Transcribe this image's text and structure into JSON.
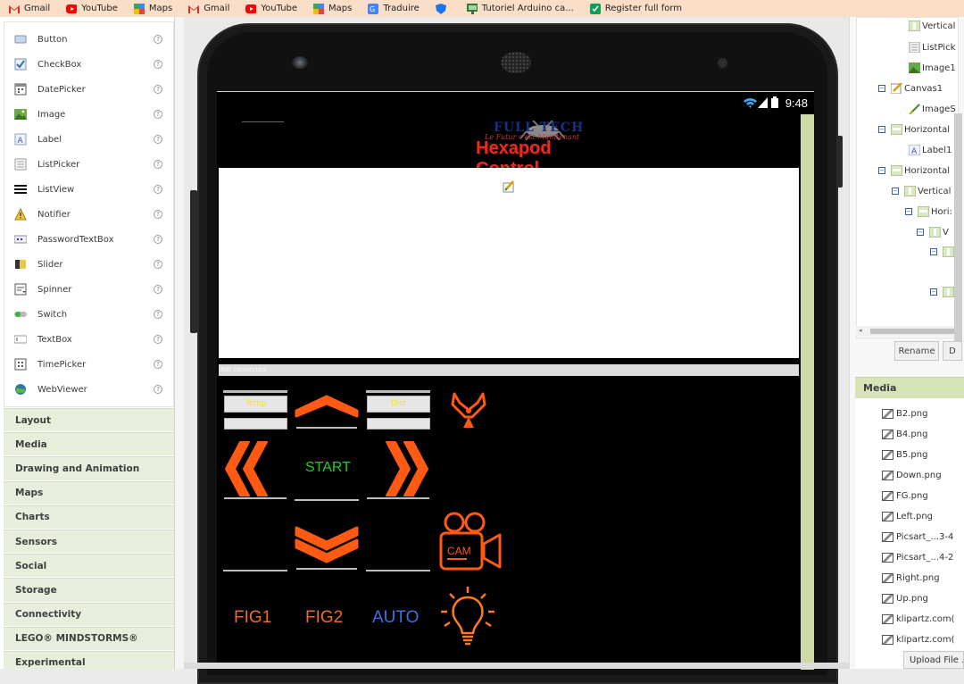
{
  "bookmarks": [
    {
      "label": "Gmail",
      "icon": "gmail-icon"
    },
    {
      "label": "YouTube",
      "icon": "youtube-icon"
    },
    {
      "label": "Maps",
      "icon": "maps-icon"
    },
    {
      "label": "Gmail",
      "icon": "gmail-icon"
    },
    {
      "label": "YouTube",
      "icon": "youtube-icon"
    },
    {
      "label": "Maps",
      "icon": "maps-icon"
    },
    {
      "label": "Traduire",
      "icon": "translate-icon"
    },
    {
      "label": "",
      "icon": "shield-icon"
    },
    {
      "label": "Tutoriel Arduino ca...",
      "icon": "monitor-icon"
    },
    {
      "label": "Register full form",
      "icon": "register-icon"
    }
  ],
  "palette": {
    "components": [
      {
        "label": "Button",
        "icon": "button-icon"
      },
      {
        "label": "CheckBox",
        "icon": "checkbox-icon"
      },
      {
        "label": "DatePicker",
        "icon": "datepicker-icon"
      },
      {
        "label": "Image",
        "icon": "image-icon"
      },
      {
        "label": "Label",
        "icon": "label-icon"
      },
      {
        "label": "ListPicker",
        "icon": "listpicker-icon"
      },
      {
        "label": "ListView",
        "icon": "listview-icon"
      },
      {
        "label": "Notifier",
        "icon": "notifier-icon"
      },
      {
        "label": "PasswordTextBox",
        "icon": "password-icon"
      },
      {
        "label": "Slider",
        "icon": "slider-icon"
      },
      {
        "label": "Spinner",
        "icon": "spinner-icon"
      },
      {
        "label": "Switch",
        "icon": "switch-icon"
      },
      {
        "label": "TextBox",
        "icon": "textbox-icon"
      },
      {
        "label": "TimePicker",
        "icon": "timepicker-icon"
      },
      {
        "label": "WebViewer",
        "icon": "webviewer-icon"
      }
    ],
    "help_glyph": "?",
    "categories": [
      "Layout",
      "Media",
      "Drawing and Animation",
      "Maps",
      "Charts",
      "Sensors",
      "Social",
      "Storage",
      "Connectivity",
      "LEGO® MINDSTORMS®",
      "Experimental"
    ]
  },
  "phone": {
    "time": "9:48",
    "logo_top": "FULL TECH",
    "logo_tagline": "Le Futur c'est Maintenant",
    "logo_title": "Hexapod Control",
    "status_strip": "Not connected",
    "box_left": "Temp",
    "box_right": "Dist",
    "start_label": "START",
    "fig1_label": "FIG1",
    "fig2_label": "FIG2",
    "auto_label": "AUTO",
    "cam_label": "CAM"
  },
  "tree": {
    "nodes": [
      {
        "label": "Vertical",
        "icon": "vertical-icon"
      },
      {
        "label": "ListPick",
        "icon": "listpicker-icon"
      },
      {
        "label": "Image1",
        "icon": "image-icon"
      },
      {
        "label": "Canvas1",
        "icon": "canvas-icon"
      },
      {
        "label": "ImageS",
        "icon": "imagesprite-icon"
      },
      {
        "label": "Horizontal",
        "icon": "horizontal-icon"
      },
      {
        "label": "Label1",
        "icon": "label-icon"
      },
      {
        "label": "Horizontal",
        "icon": "horizontal-icon"
      },
      {
        "label": "Vertical",
        "icon": "vertical-icon"
      },
      {
        "label": "Hori:",
        "icon": "horizontal-icon"
      },
      {
        "label": "V",
        "icon": "vertical-icon"
      },
      {
        "label": "",
        "icon": "vertical-icon"
      },
      {
        "label": "",
        "icon": "vertical-icon"
      }
    ],
    "collapse_glyph": "−",
    "rename_label": "Rename",
    "delete_label": "D"
  },
  "media": {
    "header": "Media",
    "files": [
      "B2.png",
      "B4.png",
      "B5.png",
      "Down.png",
      "FG.png",
      "Left.png",
      "Picsart_...3-4",
      "Picsart_...4-2",
      "Right.png",
      "Up.png",
      "klipartz.com(",
      "klipartz.com("
    ],
    "upload_label": "Upload File ..."
  },
  "colors": {
    "bookmarks_bar": "#fbdec8",
    "category_bg": "#e7eedc",
    "media_header_bg": "#d6e4b8",
    "arrow_orange": "#ff5a14",
    "start_green": "#1fd01f",
    "auto_blue": "#3f6fe6",
    "logo_red": "#e52c1d"
  }
}
